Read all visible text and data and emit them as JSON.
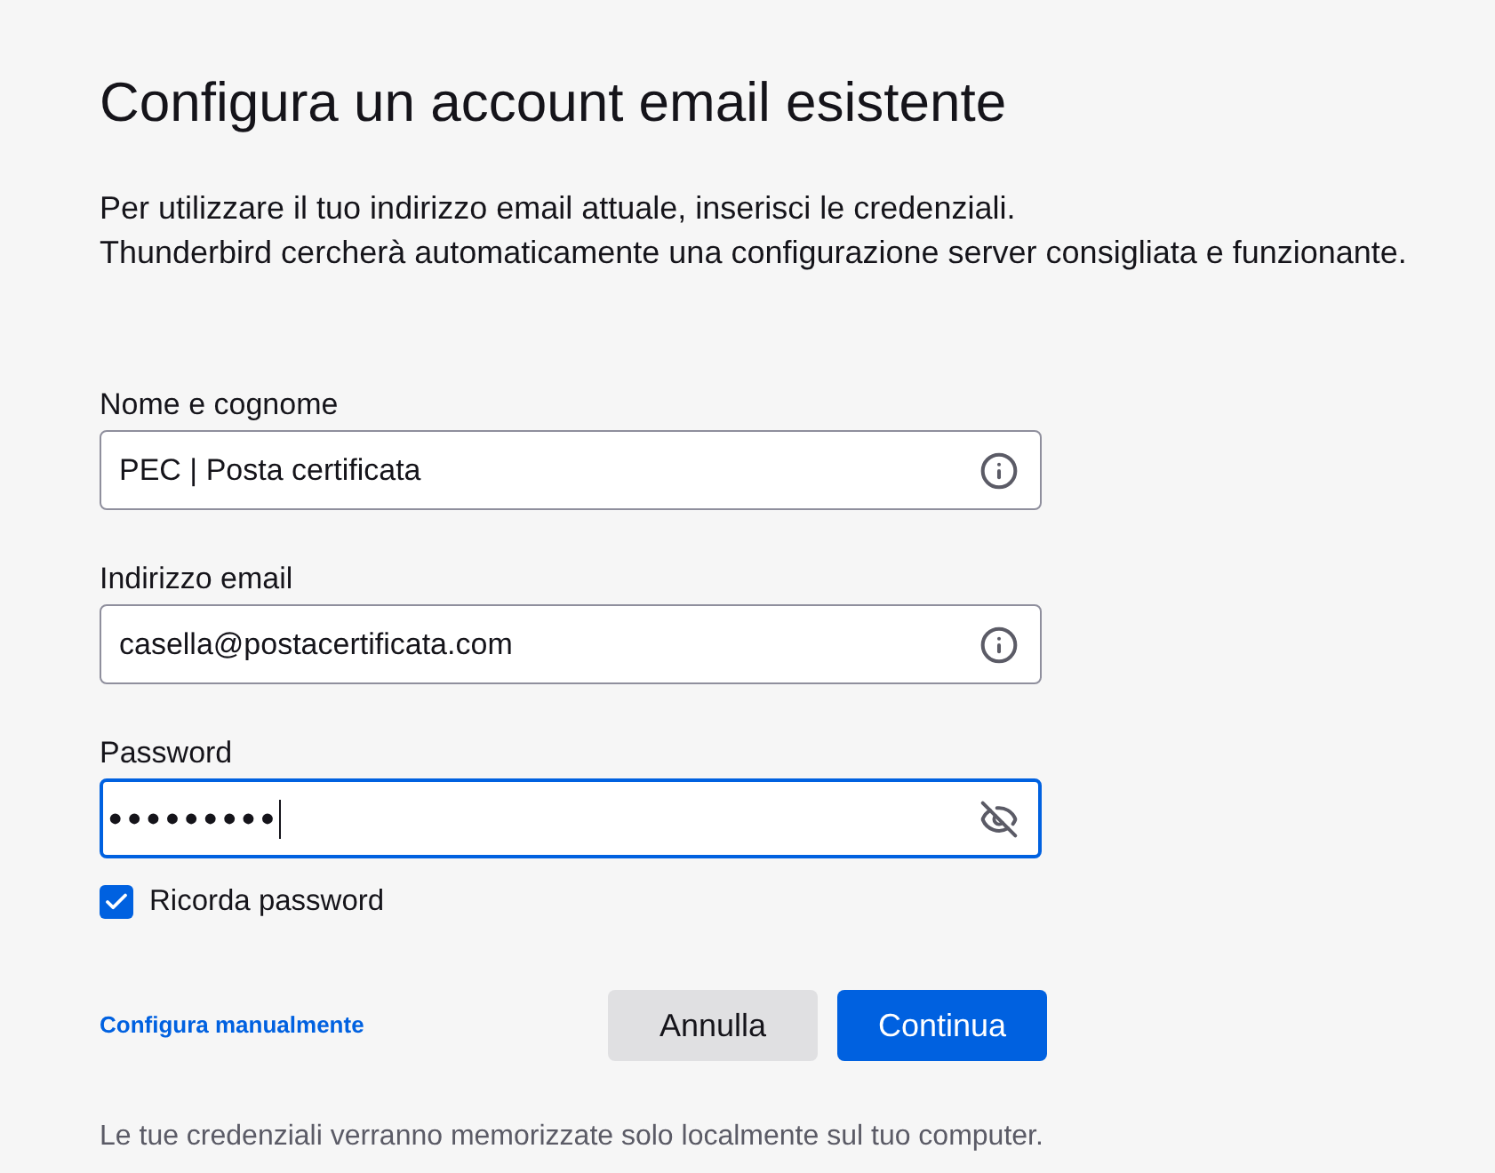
{
  "title": "Configura un account email esistente",
  "intro": [
    "Per utilizzare il tuo indirizzo email attuale, inserisci le credenziali.",
    "Thunderbird cercherà automaticamente una configurazione server consigliata e funzionante."
  ],
  "fields": [
    {
      "label": "Nome e cognome",
      "value": "PEC | Posta certificata",
      "kind": "text",
      "focused": false
    },
    {
      "label": "Indirizzo email",
      "value": "casella@postacertificata.com",
      "kind": "text",
      "focused": false
    },
    {
      "label": "Password",
      "value": "•••••••••",
      "kind": "password",
      "focused": true
    }
  ],
  "remember_password": {
    "label": "Ricorda password",
    "checked": true
  },
  "manual_config_link": "Configura manualmente",
  "buttons": [
    {
      "label": "Annulla",
      "kind": "secondary"
    },
    {
      "label": "Continua",
      "kind": "primary"
    }
  ],
  "footer": "Le tue credenziali verranno memorizzate solo localmente sul tuo computer."
}
